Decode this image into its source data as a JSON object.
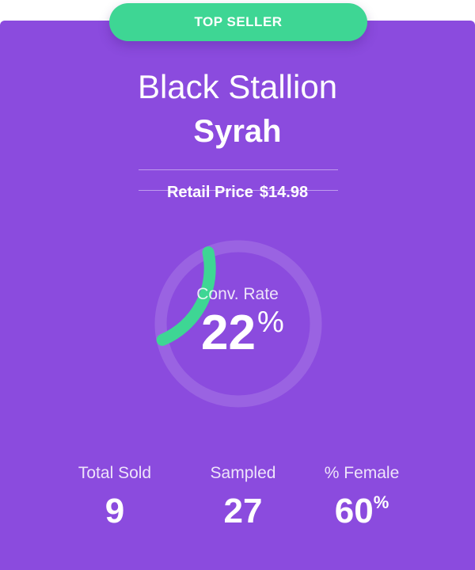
{
  "badge": {
    "label": "TOP SELLER"
  },
  "product": {
    "brand": "Black Stallion",
    "varietal": "Syrah"
  },
  "price": {
    "label": "Retail Price",
    "value": "$14.98"
  },
  "conversion": {
    "label": "Conv. Rate",
    "value": "22",
    "unit": "%",
    "fraction": 0.22
  },
  "stats": [
    {
      "label": "Total Sold",
      "value": "9",
      "unit": ""
    },
    {
      "label": "Sampled",
      "value": "27",
      "unit": ""
    },
    {
      "label": "% Female",
      "value": "60",
      "unit": "%"
    }
  ],
  "colors": {
    "card": "#8b4bde",
    "accent": "#3ed694",
    "track": "#9a63e2",
    "text": "#ffffff"
  }
}
